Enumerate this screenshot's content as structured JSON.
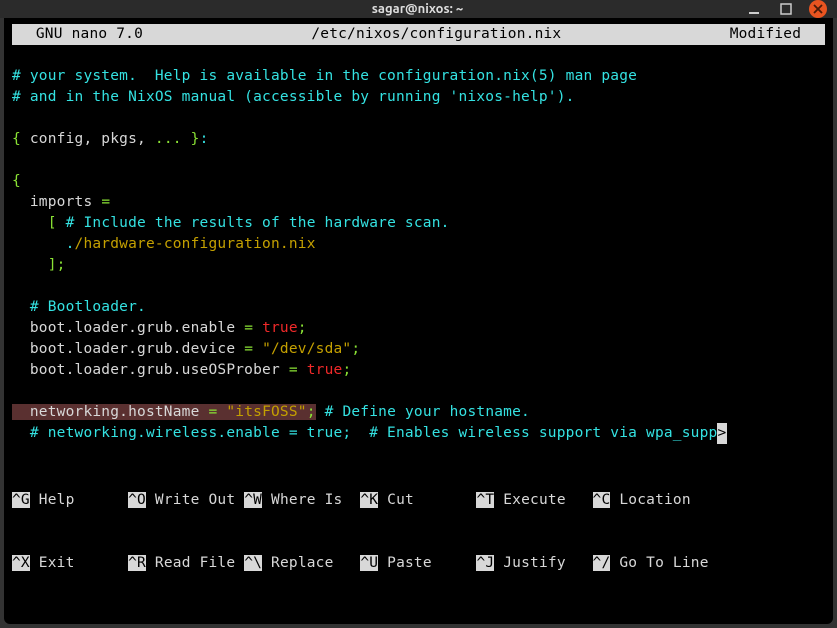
{
  "window": {
    "title": "sagar@nixos: ~"
  },
  "nano": {
    "app": "  GNU nano 7.0",
    "file": "/etc/nixos/configuration.nix",
    "status": "Modified  "
  },
  "lines": {
    "l1a": "# your system.  Help is available in the configuration.nix(5) man page",
    "l2a": "# and in the NixOS manual (accessible by running 'nixos-help').",
    "l4_brace": "{",
    "l4_args": " config, pkgs, ",
    "l4_dots": "...",
    "l4_close": " }",
    "l4_colon": ":",
    "l6_brace": "{",
    "l7_imports": "  imports ",
    "l7_eq": "=",
    "l8_br": "    [ ",
    "l8_comment": "# Include the results of the hardware scan.",
    "l9_dot": "      .",
    "l9_path": "/hardware-configuration.nix",
    "l10_close": "    ];",
    "l12_comment": "  # Bootloader.",
    "l13a": "  boot.loader.grub.enable ",
    "l13eq": "= ",
    "l13v": "true",
    "l13s": ";",
    "l14a": "  boot.loader.grub.device ",
    "l14eq": "= ",
    "l14v": "\"/dev/sda\"",
    "l14s": ";",
    "l15a": "  boot.loader.grub.useOSProber ",
    "l15eq": "= ",
    "l15v": "true",
    "l15s": ";",
    "l17a": "  networking.hostName ",
    "l17eq": "= ",
    "l17v": "\"itsFOSS\"",
    "l17s": ";",
    "l17c": " # Define your hostname.",
    "l18": "  # networking.wireless.enable = true;  # Enables wireless support via wpa_supp",
    "indicator": ">"
  },
  "help": {
    "r1": {
      "k1": "^G",
      "t1": " Help      ",
      "k2": "^O",
      "t2": " Write Out ",
      "k3": "^W",
      "t3": " Where Is  ",
      "k4": "^K",
      "t4": " Cut       ",
      "k5": "^T",
      "t5": " Execute   ",
      "k6": "^C",
      "t6": " Location"
    },
    "r2": {
      "k1": "^X",
      "t1": " Exit      ",
      "k2": "^R",
      "t2": " Read File ",
      "k3": "^\\",
      "t3": " Replace   ",
      "k4": "^U",
      "t4": " Paste     ",
      "k5": "^J",
      "t5": " Justify   ",
      "k6": "^/",
      "t6": " Go To Line"
    }
  }
}
